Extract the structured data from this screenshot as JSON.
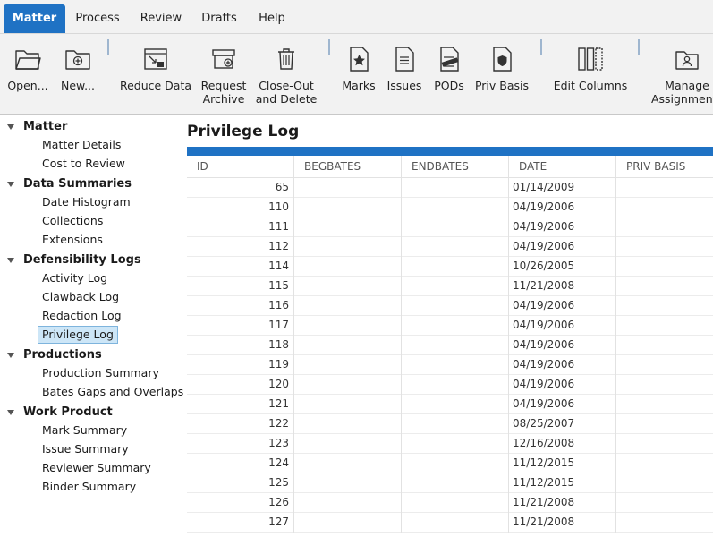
{
  "menu": {
    "tabs": [
      "Matter",
      "Process",
      "Review",
      "Drafts",
      "Help"
    ],
    "active": "Matter"
  },
  "ribbon": {
    "buttons": [
      {
        "label": "Open...",
        "icon": "folder-open-icon"
      },
      {
        "label": "New...",
        "icon": "folder-new-icon"
      },
      {
        "label": "Reduce Data",
        "icon": "reduce-data-icon"
      },
      {
        "label": "Request\nArchive",
        "icon": "archive-box-icon"
      },
      {
        "label": "Close-Out\nand Delete",
        "icon": "trash-icon"
      },
      {
        "label": "Marks",
        "icon": "document-star-icon"
      },
      {
        "label": "Issues",
        "icon": "document-lines-icon"
      },
      {
        "label": "PODs",
        "icon": "document-conf-icon"
      },
      {
        "label": "Priv Basis",
        "icon": "document-shield-icon"
      },
      {
        "label": "Edit Columns",
        "icon": "columns-icon"
      },
      {
        "label": "Manage\nAssignments",
        "icon": "assignment-icon"
      }
    ]
  },
  "sidebar": {
    "sections": [
      {
        "title": "Matter",
        "items": [
          "Matter Details",
          "Cost to Review"
        ]
      },
      {
        "title": "Data Summaries",
        "items": [
          "Date Histogram",
          "Collections",
          "Extensions"
        ]
      },
      {
        "title": "Defensibility Logs",
        "items": [
          "Activity Log",
          "Clawback Log",
          "Redaction Log",
          "Privilege Log"
        ]
      },
      {
        "title": "Productions",
        "items": [
          "Production Summary",
          "Bates Gaps and Overlaps"
        ]
      },
      {
        "title": "Work Product",
        "items": [
          "Mark Summary",
          "Issue Summary",
          "Reviewer Summary",
          "Binder Summary"
        ]
      }
    ],
    "selected": "Privilege Log"
  },
  "main": {
    "title": "Privilege Log",
    "accent_color": "#1f72c4",
    "columns": [
      "ID",
      "BEGBATES",
      "ENDBATES",
      "DATE",
      "PRIV BASIS"
    ],
    "rows": [
      {
        "id": "65",
        "begbates": "",
        "endbates": "",
        "date": "01/14/2009",
        "priv_basis": ""
      },
      {
        "id": "110",
        "begbates": "",
        "endbates": "",
        "date": "04/19/2006",
        "priv_basis": ""
      },
      {
        "id": "111",
        "begbates": "",
        "endbates": "",
        "date": "04/19/2006",
        "priv_basis": ""
      },
      {
        "id": "112",
        "begbates": "",
        "endbates": "",
        "date": "04/19/2006",
        "priv_basis": ""
      },
      {
        "id": "114",
        "begbates": "",
        "endbates": "",
        "date": "10/26/2005",
        "priv_basis": ""
      },
      {
        "id": "115",
        "begbates": "",
        "endbates": "",
        "date": "11/21/2008",
        "priv_basis": ""
      },
      {
        "id": "116",
        "begbates": "",
        "endbates": "",
        "date": "04/19/2006",
        "priv_basis": ""
      },
      {
        "id": "117",
        "begbates": "",
        "endbates": "",
        "date": "04/19/2006",
        "priv_basis": ""
      },
      {
        "id": "118",
        "begbates": "",
        "endbates": "",
        "date": "04/19/2006",
        "priv_basis": ""
      },
      {
        "id": "119",
        "begbates": "",
        "endbates": "",
        "date": "04/19/2006",
        "priv_basis": ""
      },
      {
        "id": "120",
        "begbates": "",
        "endbates": "",
        "date": "04/19/2006",
        "priv_basis": ""
      },
      {
        "id": "121",
        "begbates": "",
        "endbates": "",
        "date": "04/19/2006",
        "priv_basis": ""
      },
      {
        "id": "122",
        "begbates": "",
        "endbates": "",
        "date": "08/25/2007",
        "priv_basis": ""
      },
      {
        "id": "123",
        "begbates": "",
        "endbates": "",
        "date": "12/16/2008",
        "priv_basis": ""
      },
      {
        "id": "124",
        "begbates": "",
        "endbates": "",
        "date": "11/12/2015",
        "priv_basis": ""
      },
      {
        "id": "125",
        "begbates": "",
        "endbates": "",
        "date": "11/12/2015",
        "priv_basis": ""
      },
      {
        "id": "126",
        "begbates": "",
        "endbates": "",
        "date": "11/21/2008",
        "priv_basis": ""
      },
      {
        "id": "127",
        "begbates": "",
        "endbates": "",
        "date": "11/21/2008",
        "priv_basis": ""
      }
    ]
  }
}
